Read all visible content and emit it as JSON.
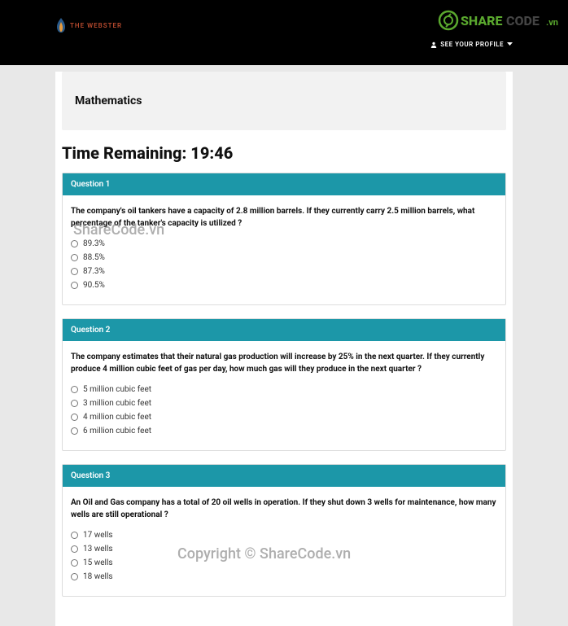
{
  "header": {
    "logo_text": "THE WEBSTER",
    "profile_link": "SEE YOUR PROFILE",
    "badge_text": "SHARECODE.vn"
  },
  "subject": "Mathematics",
  "timer_label": "Time Remaining: 19:46",
  "questions": [
    {
      "label": "Question 1",
      "text": "The company's oil tankers have a capacity of 2.8 million barrels. If they currently carry 2.5 million barrels, what percentage of the tanker's capacity is utilized ?",
      "options": [
        "89.3%",
        "88.5%",
        "87.3%",
        "90.5%"
      ]
    },
    {
      "label": "Question 2",
      "text": "The company estimates that their natural gas production will increase by 25% in the next quarter. If they currently produce 4 million cubic feet of gas per day, how much gas will they produce in the next quarter ?",
      "options": [
        "5 million cubic feet",
        "3 million cubic feet",
        "4 million cubic feet",
        "6 million cubic feet"
      ]
    },
    {
      "label": "Question 3",
      "text": "An Oil and Gas company has a total of 20 oil wells in operation. If they shut down 3 wells for maintenance, how many wells are still operational ?",
      "options": [
        "17 wells",
        "13 wells",
        "15 wells",
        "18 wells"
      ]
    }
  ],
  "watermarks": {
    "wm1": "ShareCode.vn",
    "wm2": "Copyright © ShareCode.vn"
  }
}
